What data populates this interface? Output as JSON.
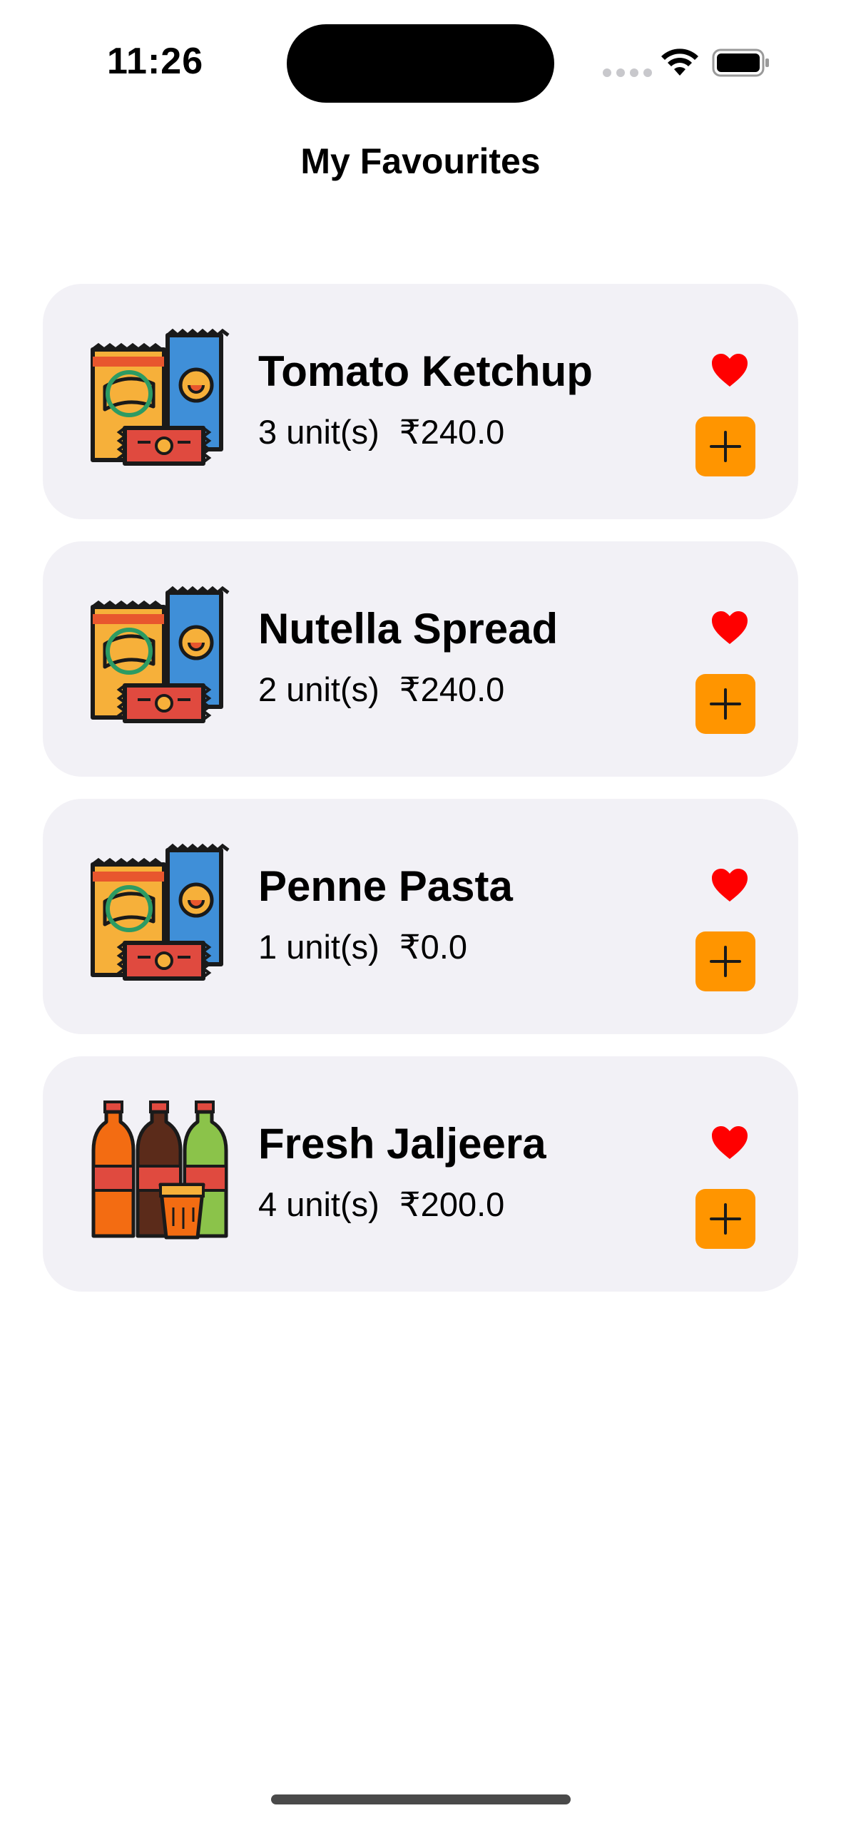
{
  "status_bar": {
    "time": "11:26",
    "icons": [
      "signal-dots-icon",
      "wifi-icon",
      "battery-icon"
    ]
  },
  "header": {
    "title": "My Favourites"
  },
  "colors": {
    "card_background": "#f2f1f6",
    "heart": "#ff0000",
    "add_button": "#ff9500",
    "text": "#000000"
  },
  "favourites": [
    {
      "name": "Tomato Ketchup",
      "units": "3 unit(s)",
      "price": "₹240.0",
      "image": "snacks-icon",
      "favourite": true
    },
    {
      "name": "Nutella Spread",
      "units": "2 unit(s)",
      "price": "₹240.0",
      "image": "snacks-icon",
      "favourite": true
    },
    {
      "name": "Penne Pasta",
      "units": "1 unit(s)",
      "price": "₹0.0",
      "image": "snacks-icon",
      "favourite": true
    },
    {
      "name": "Fresh Jaljeera",
      "units": "4 unit(s)",
      "price": "₹200.0",
      "image": "drinks-icon",
      "favourite": true
    }
  ]
}
